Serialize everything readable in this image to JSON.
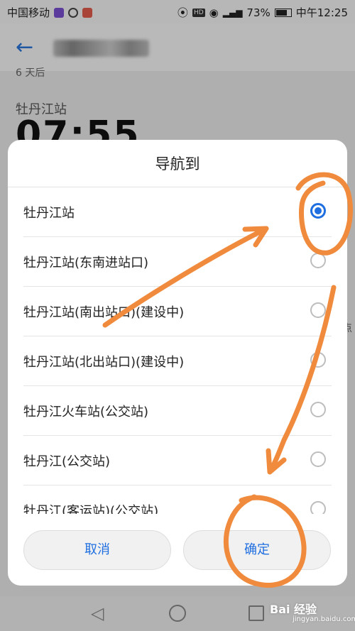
{
  "status_bar": {
    "carrier": "中国移动",
    "indicators": [
      "location-icon",
      "hd-icon",
      "eye-icon",
      "4g-signal-icon"
    ],
    "battery": "73%",
    "time": "中午12:25"
  },
  "background": {
    "days": "6 天后",
    "station": "牡丹江站",
    "time": "07:55",
    "side_text": "点"
  },
  "dialog": {
    "title": "导航到",
    "options": [
      {
        "label": "牡丹江站",
        "selected": true
      },
      {
        "label": "牡丹江站(东南进站口)",
        "selected": false
      },
      {
        "label": "牡丹江站(南出站口)(建设中)",
        "selected": false
      },
      {
        "label": "牡丹江站(北出站口)(建设中)",
        "selected": false
      },
      {
        "label": "牡丹江火车站(公交站)",
        "selected": false
      },
      {
        "label": "牡丹江(公交站)",
        "selected": false
      },
      {
        "label": "牡丹江(客运站)(公交站)",
        "selected": false
      }
    ],
    "cancel_label": "取消",
    "confirm_label": "确定"
  },
  "watermark": {
    "text": "Bai 经验",
    "sub": "jingyan.baidu.com"
  },
  "colors": {
    "accent": "#1f6fe0",
    "annotation": "#f08a3c"
  }
}
